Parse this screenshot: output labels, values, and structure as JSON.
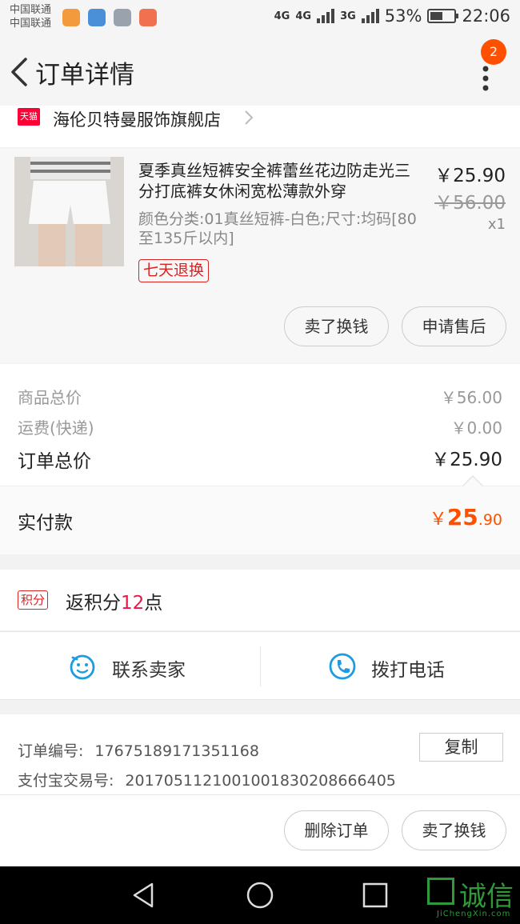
{
  "status_bar": {
    "carrier1": "中国联通",
    "carrier2": "中国联通",
    "net1": "4G",
    "net2": "4G",
    "net3": "3G",
    "battery": "53%",
    "battery_level": 0.53,
    "time": "22:06"
  },
  "header": {
    "title": "订单详情",
    "badge": "2"
  },
  "store": {
    "icon_text": "天猫",
    "name": "海伦贝特曼服饰旗舰店"
  },
  "product": {
    "title": "夏季真丝短裤安全裤蕾丝花边防走光三分打底裤女休闲宽松薄款外穿",
    "spec": "颜色分类:01真丝短裤-白色;尺寸:均码[80至135斤以内]",
    "tag": "七天退换",
    "price": "￥25.90",
    "original_price": "￥56.00",
    "qty": "x1",
    "btn_sell": "卖了换钱",
    "btn_after_sale": "申请售后"
  },
  "totals": {
    "goods_label": "商品总价",
    "goods_value": "￥56.00",
    "shipping_label": "运费(快递)",
    "shipping_value": "￥0.00",
    "order_label": "订单总价",
    "order_value": "￥25.90",
    "paid_label": "实付款",
    "paid_currency": "￥",
    "paid_int": "25",
    "paid_dec": ".90"
  },
  "points": {
    "tag": "积分",
    "prefix": "返积分",
    "num": "12",
    "suffix": "点"
  },
  "contact": {
    "seller": "联系卖家",
    "phone": "拨打电话"
  },
  "order_info": {
    "order_no_label": "订单编号:",
    "order_no": "17675189171351168",
    "copy": "复制",
    "alipay_label": "支付宝交易号:",
    "alipay_no": "2017051121001001830208666405"
  },
  "bottom_actions": {
    "delete": "删除订单",
    "sell": "卖了换钱"
  },
  "watermark": {
    "text": "诚信",
    "sub": "JiChengXin.com"
  },
  "colors": {
    "accent": "#ff5000",
    "tmall": "#ff0036",
    "points": "#e8174a"
  }
}
